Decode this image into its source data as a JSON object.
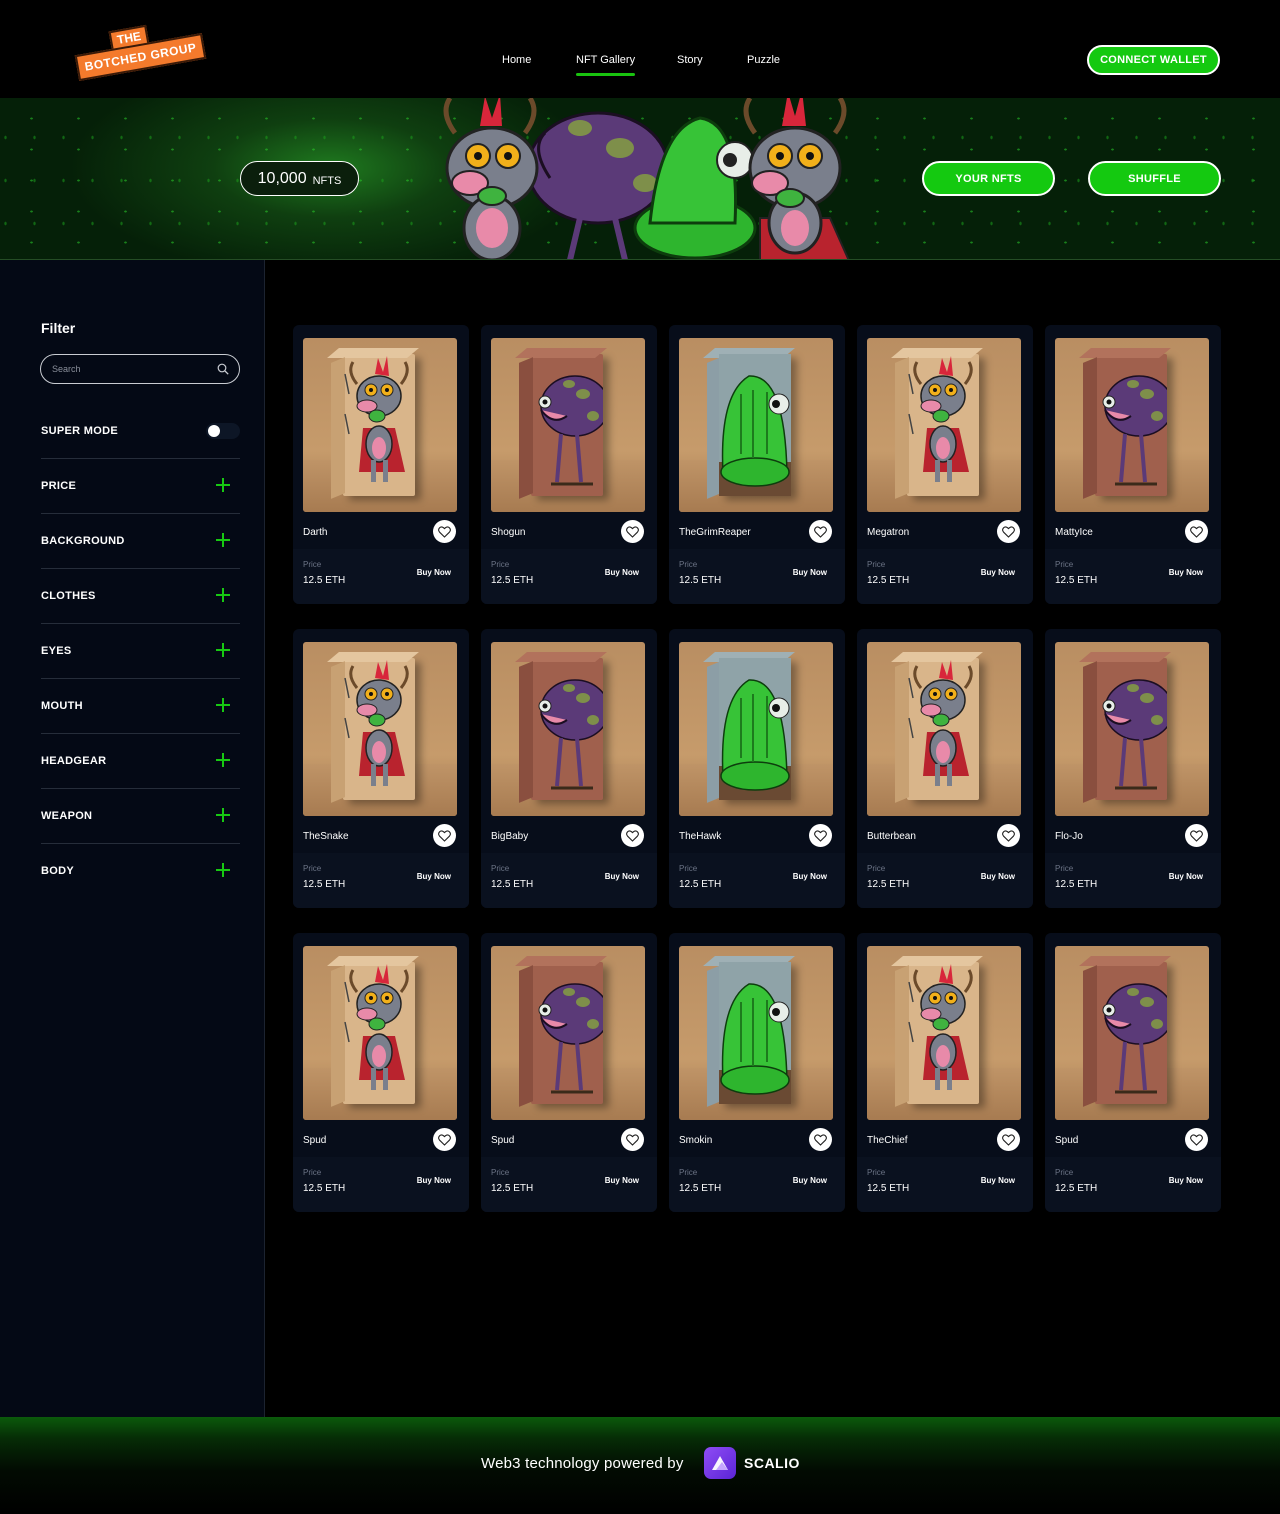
{
  "brand": {
    "logo_line1": "THE",
    "logo_line2": "BOTCHED GROUP"
  },
  "nav": {
    "items": [
      "Home",
      "NFT Gallery",
      "Story",
      "Puzzle"
    ],
    "active": "NFT Gallery"
  },
  "header": {
    "connect_label": "CONNECT WALLET"
  },
  "hero": {
    "count": "10,000",
    "count_unit": "NFTS",
    "your_nfts_label": "YOUR NFTS",
    "shuffle_label": "SHUFFLE"
  },
  "filter": {
    "title": "Filter",
    "search_placeholder": "Search",
    "super_mode_label": "SUPER MODE",
    "super_mode_on": false,
    "groups": [
      "PRICE",
      "BACKGROUND",
      "CLOTHES",
      "EYES",
      "MOUTH",
      "HEADGEAR",
      "WEAPON",
      "BODY"
    ]
  },
  "cards": [
    {
      "name": "Darth",
      "price_label": "Price",
      "price": "12.5 ETH",
      "buy": "Buy Now",
      "art": "goat"
    },
    {
      "name": "Shogun",
      "price_label": "Price",
      "price": "12.5 ETH",
      "buy": "Buy Now",
      "art": "bug"
    },
    {
      "name": "TheGrimReaper",
      "price_label": "Price",
      "price": "12.5 ETH",
      "buy": "Buy Now",
      "art": "slime"
    },
    {
      "name": "Megatron",
      "price_label": "Price",
      "price": "12.5 ETH",
      "buy": "Buy Now",
      "art": "goat"
    },
    {
      "name": "MattyIce",
      "price_label": "Price",
      "price": "12.5 ETH",
      "buy": "Buy Now",
      "art": "bug"
    },
    {
      "name": "TheSnake",
      "price_label": "Price",
      "price": "12.5 ETH",
      "buy": "Buy Now",
      "art": "goat"
    },
    {
      "name": "BigBaby",
      "price_label": "Price",
      "price": "12.5 ETH",
      "buy": "Buy Now",
      "art": "bug"
    },
    {
      "name": "TheHawk",
      "price_label": "Price",
      "price": "12.5 ETH",
      "buy": "Buy Now",
      "art": "slime"
    },
    {
      "name": "Butterbean",
      "price_label": "Price",
      "price": "12.5 ETH",
      "buy": "Buy Now",
      "art": "goat"
    },
    {
      "name": "Flo-Jo",
      "price_label": "Price",
      "price": "12.5 ETH",
      "buy": "Buy Now",
      "art": "bug"
    },
    {
      "name": "Spud",
      "price_label": "Price",
      "price": "12.5 ETH",
      "buy": "Buy Now",
      "art": "goat"
    },
    {
      "name": "Spud",
      "price_label": "Price",
      "price": "12.5 ETH",
      "buy": "Buy Now",
      "art": "bug"
    },
    {
      "name": "Smokin",
      "price_label": "Price",
      "price": "12.5 ETH",
      "buy": "Buy Now",
      "art": "slime"
    },
    {
      "name": "TheChief",
      "price_label": "Price",
      "price": "12.5 ETH",
      "buy": "Buy Now",
      "art": "goat"
    },
    {
      "name": "Spud",
      "price_label": "Price",
      "price": "12.5 ETH",
      "buy": "Buy Now",
      "art": "bug"
    }
  ],
  "footer": {
    "powered_text": "Web3 technology powered by",
    "brand": "SCALIO"
  },
  "colors": {
    "accent": "#14c910",
    "logo": "#f47a2c",
    "sidebar_bg": "#040915",
    "card_bg": "#070d1a"
  }
}
